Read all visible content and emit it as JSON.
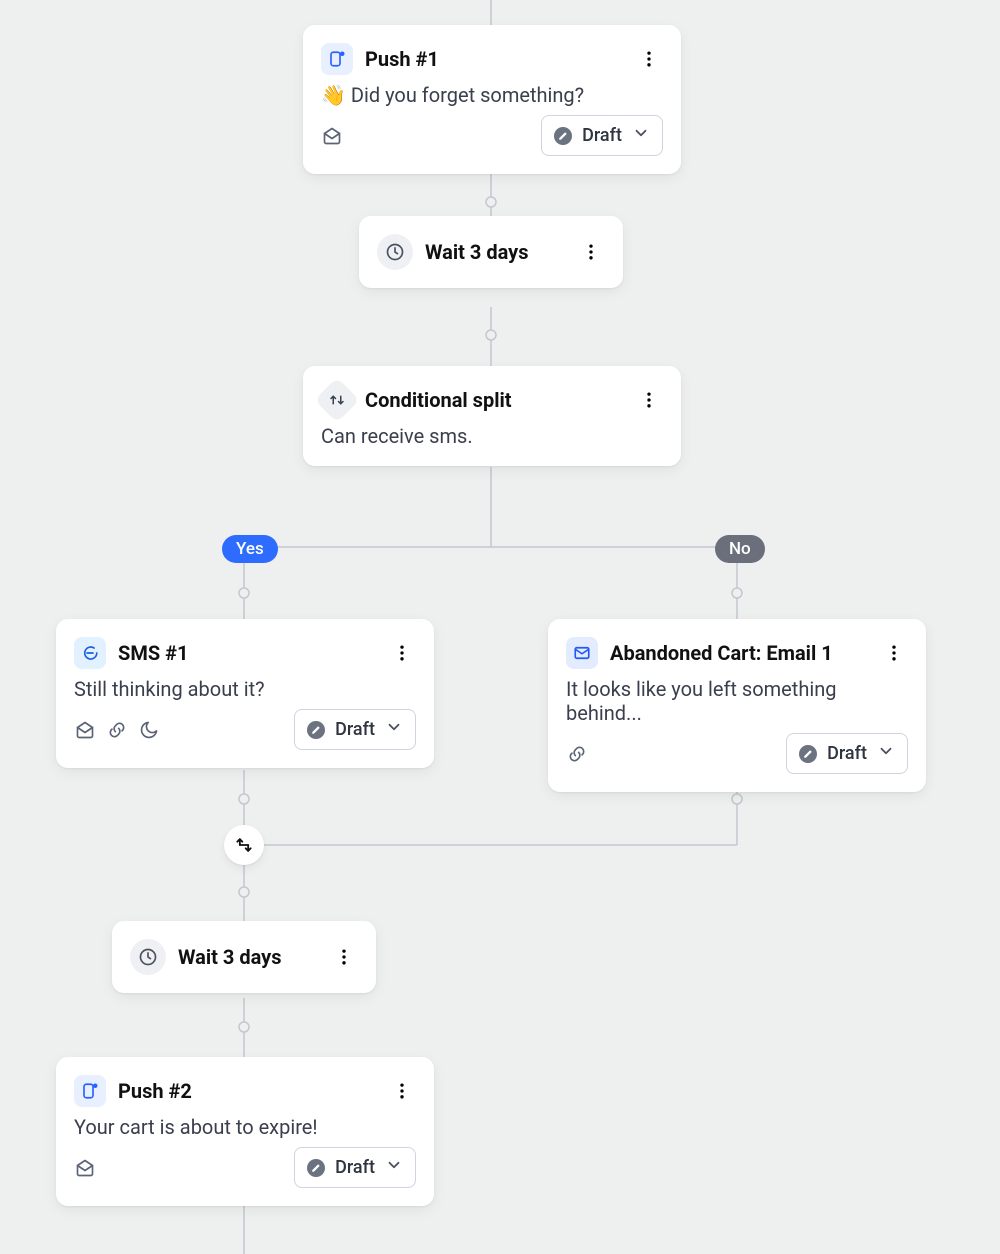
{
  "colors": {
    "yes": "#2e6bff",
    "no": "#6a6f7b"
  },
  "status": {
    "draft": "Draft"
  },
  "split": {
    "yes": "Yes",
    "no": "No"
  },
  "nodes": {
    "push1": {
      "title": "Push #1",
      "desc": "👋 Did you forget something?",
      "status_key": "draft"
    },
    "wait1": {
      "title": "Wait 3 days"
    },
    "cond": {
      "title": "Conditional split",
      "desc": "Can receive sms."
    },
    "sms1": {
      "title": "SMS #1",
      "desc": "Still thinking about it?",
      "status_key": "draft"
    },
    "email1": {
      "title": "Abandoned Cart: Email 1",
      "desc": "It looks like you left something behind...",
      "status_key": "draft"
    },
    "wait2": {
      "title": "Wait 3 days"
    },
    "push2": {
      "title": "Push #2",
      "desc": "Your cart is about to expire!",
      "status_key": "draft"
    }
  }
}
